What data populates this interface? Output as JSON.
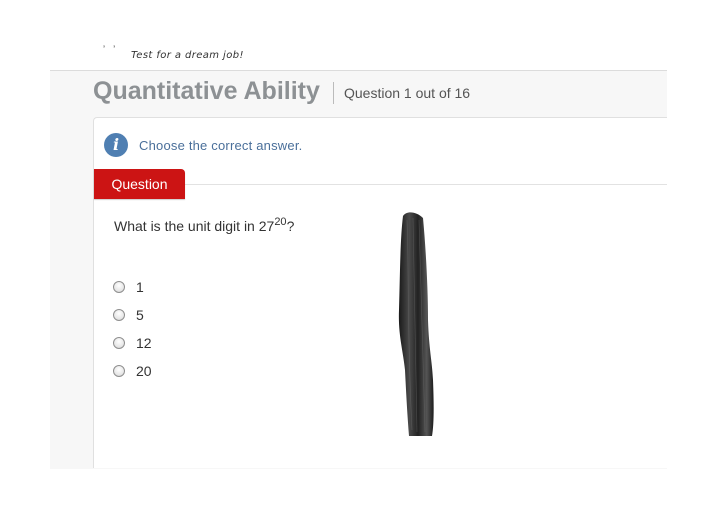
{
  "brand": {
    "tagline": "Test for a dream job!",
    "logo_fragment": "’ ’"
  },
  "header": {
    "title": "Quantitative Ability",
    "question_counter": "Question 1 out of 16"
  },
  "instruction": {
    "icon": "info-icon",
    "text": "Choose the correct answer."
  },
  "question": {
    "tab_label": "Question",
    "text_prefix": "What is the unit digit in 27",
    "exponent": "20",
    "text_suffix": "?",
    "options": [
      {
        "label": "1",
        "selected": false
      },
      {
        "label": "5",
        "selected": false
      },
      {
        "label": "12",
        "selected": false
      },
      {
        "label": "20",
        "selected": false
      }
    ]
  },
  "colors": {
    "accent_red": "#cc1414",
    "info_blue": "#4f7fb2",
    "title_gray": "#8d9194"
  }
}
